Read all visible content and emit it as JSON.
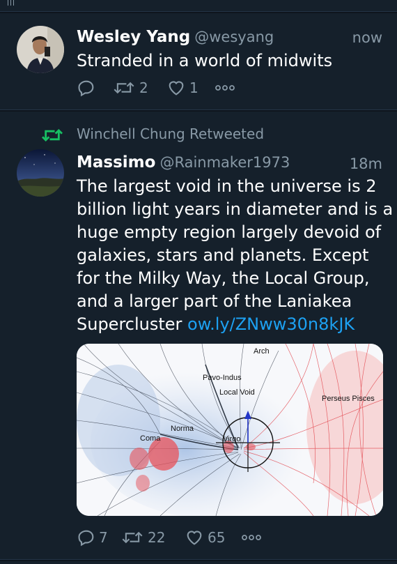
{
  "tweets": [
    {
      "name": "Wesley Yang",
      "handle": "@wesyang",
      "time": "now",
      "text": "Stranded in a world of midwits",
      "retweets": "2",
      "likes": "1"
    },
    {
      "retweeted_by": "Winchell Chung Retweeted",
      "name": "Massimo",
      "handle": "@Rainmaker1973",
      "time": "18m",
      "text_lines": [
        "The largest void in the universe is 2",
        "billion light years in diameter and is a",
        "huge empty region largely devoid of",
        "galaxies, stars and planets. Except",
        "for the Milky Way, the Local Group,",
        "and a larger part of the Laniakea"
      ],
      "text_last": "Supercluster",
      "link": "ow.ly/ZNww30n8kJK",
      "replies": "7",
      "retweets": "22",
      "likes": "65",
      "media_labels": {
        "arch": "Arch",
        "pavo_indus": "Pavo-Indus",
        "local_void": "Local Void",
        "perseus": "Perseus Pisces",
        "norma": "Norma",
        "coma": "Coma",
        "virgo": "Virgo"
      }
    }
  ],
  "colors": {
    "background": "#15202b",
    "secondary_text": "#8899a6",
    "link": "#1da1f2",
    "retweet_green": "#17bf63"
  }
}
